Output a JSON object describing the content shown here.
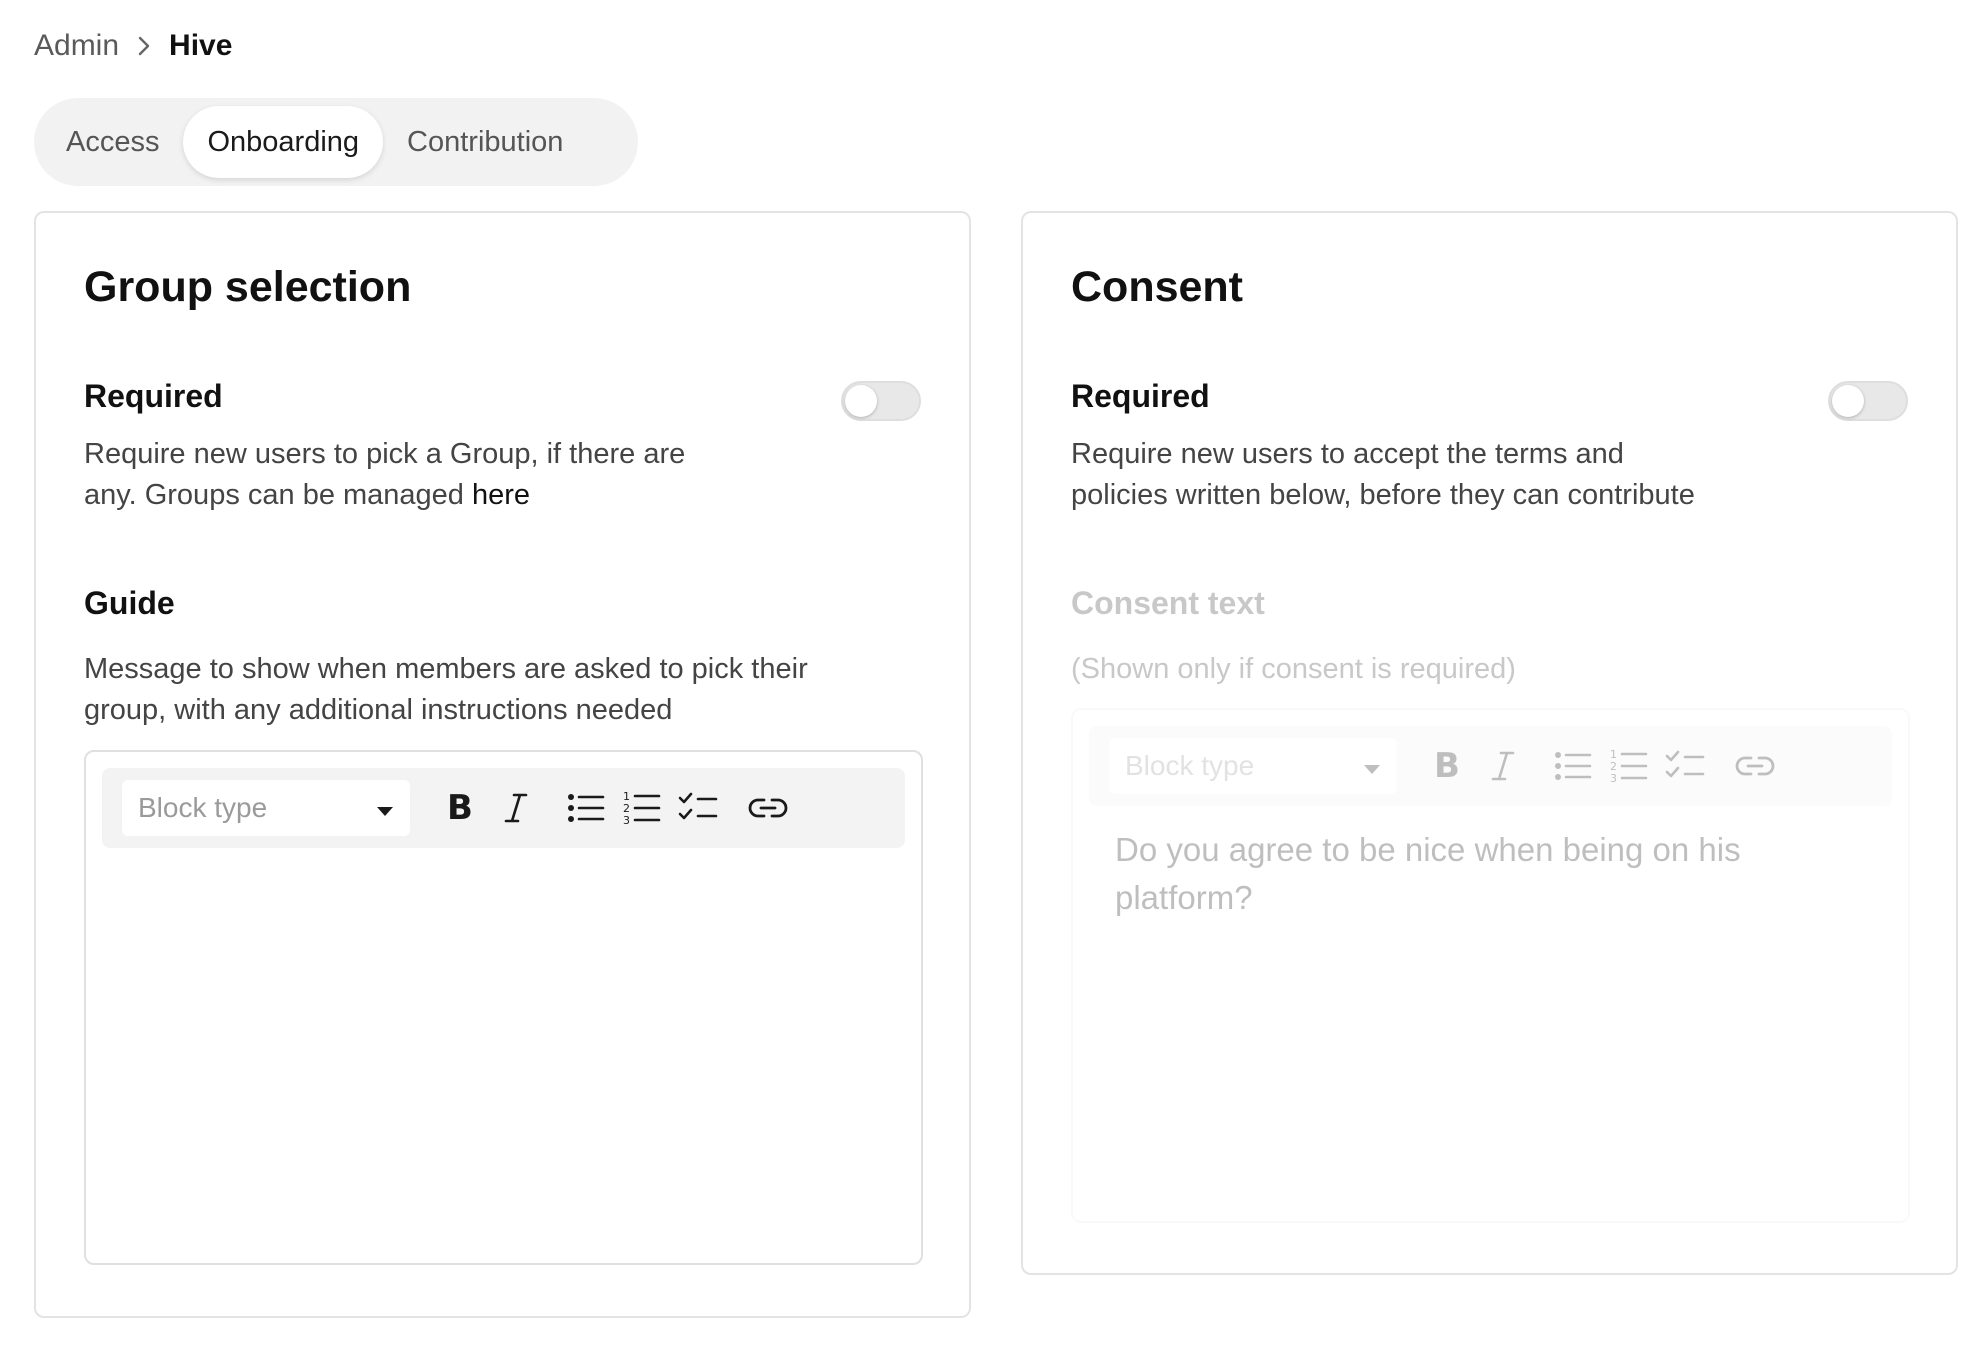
{
  "breadcrumb": {
    "parent": "Admin",
    "current": "Hive"
  },
  "tabs": [
    {
      "label": "Access",
      "active": false
    },
    {
      "label": "Onboarding",
      "active": true
    },
    {
      "label": "Contribution",
      "active": false
    }
  ],
  "group_selection": {
    "title": "Group selection",
    "required": {
      "label": "Required",
      "enabled": false,
      "description_line1": "Require new users to pick a Group, if there are",
      "description_line2_prefix": "any. Groups can be managed ",
      "description_link": "here"
    },
    "guide": {
      "label": "Guide",
      "description_line1": "Message to show when members are asked to pick their",
      "description_line2": "group, with any additional instructions needed"
    },
    "editor": {
      "block_type_placeholder": "Block type",
      "content": ""
    }
  },
  "consent": {
    "title": "Consent",
    "required": {
      "label": "Required",
      "enabled": false,
      "description_line1": "Require new users to accept the terms and",
      "description_line2": "policies written below, before they can contribute"
    },
    "consent_text": {
      "label": "Consent text",
      "hint": "(Shown only if consent is required)"
    },
    "editor": {
      "block_type_placeholder": "Block type",
      "content": "Do you agree to be nice when being on his platform?"
    }
  },
  "colors": {
    "accent_text": "#111111",
    "muted_text": "#444444",
    "border": "#e3e3e3",
    "tab_bg": "#f2f2f2",
    "toggle_off": "#e8e8e8"
  },
  "icons": [
    "chevron-right-icon",
    "caret-down-icon",
    "bold-icon",
    "italic-icon",
    "bullet-list-icon",
    "numbered-list-icon",
    "checklist-icon",
    "link-icon"
  ]
}
